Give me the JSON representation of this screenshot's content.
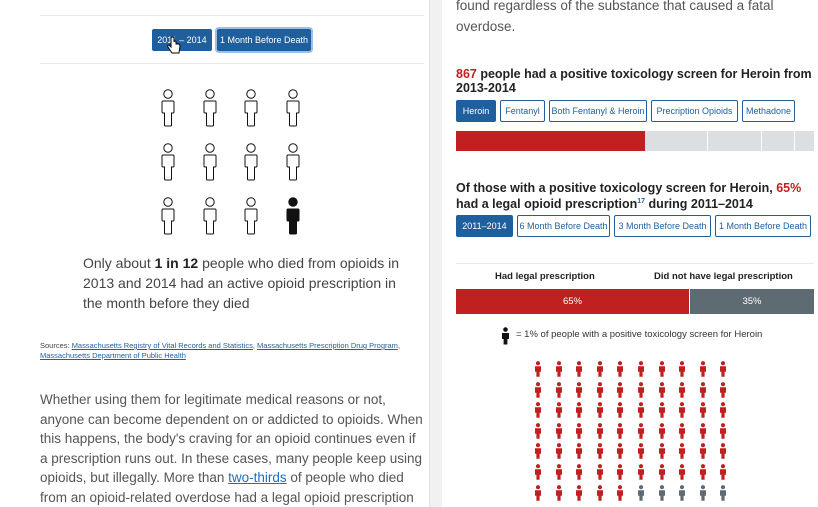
{
  "left": {
    "buttons": [
      "2011 – 2014",
      "1 Month Before Death"
    ],
    "people_grid": {
      "rows": 3,
      "cols": 4,
      "highlighted_index": 11
    },
    "stat": {
      "prefix": "Only about ",
      "bold": "1 in 12",
      "suffix": " people who died from opioids in 2013 and 2014 had an active opioid prescription in the month before they died"
    },
    "sources": {
      "label": "Sources: ",
      "links": [
        "Massachusetts Registry of Vital Records and Statistics",
        "Massachusetts Prescription Drug Program",
        "Massachusetts Department of Public Health"
      ]
    },
    "body": {
      "before_link": "Whether using them for legitimate medical reasons or not, anyone can become dependent on or addicted to opioids. When this happens, the body's craving for an opioid continues even if a prescription runs out. In these cases, many people keep using opioids, but illegally. More than ",
      "link": "two-thirds",
      "after_link": " of people who died from an opioid-related overdose had a legal opioid prescription at some"
    }
  },
  "right": {
    "top_text": "found regardless of the substance that caused a fatal overdose.",
    "h1": {
      "count": "867",
      "text_a": " people had a positive toxicology screen for ",
      "drug": "Heroin",
      "text_b": " from 2013-2014"
    },
    "substance_tabs": [
      "Heroin",
      "Fentanyl",
      "Both Fentanyl & Heroin",
      "Precription Opioids",
      "Methadone"
    ],
    "h2": {
      "text_a": "Of those with a positive toxicology screen for ",
      "drug": "Heroin,",
      "pct": "65%",
      "text_b": "had a legal opioid prescription",
      "sup": "17",
      "text_c": " during 2011–2014"
    },
    "period_tabs": [
      "2011–2014",
      "6 Month Before Death",
      "3 Month Before Death",
      "1 Month Before Death"
    ],
    "split": {
      "had_label": "Had legal prescription",
      "not_label": "Did not have legal prescription",
      "had_value": "65%",
      "not_value": "35%",
      "had_fraction": 0.65
    },
    "legend": "= 1% of people with a positive toxicology screen for Heroin",
    "colors": {
      "red": "#c0201f",
      "gray": "#5f6b73",
      "blue": "#1f5f9e"
    }
  }
}
